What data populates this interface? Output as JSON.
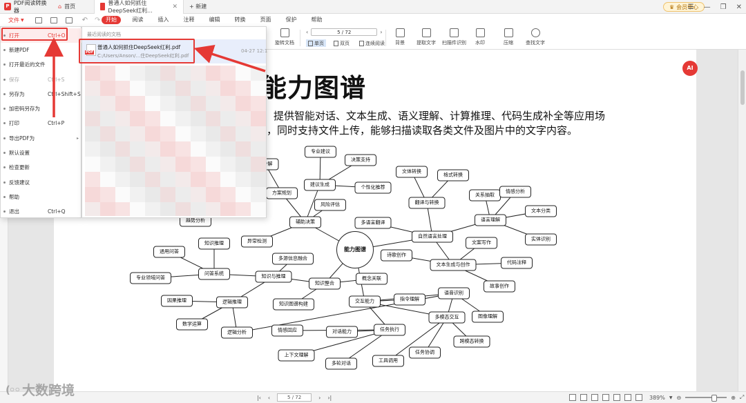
{
  "titlebar": {
    "app_title": "PDF阅读转换器",
    "home_tab": "首页",
    "doc_tab": "普通人如何抓住DeepSeek红利...",
    "new_tab": "+ 新建",
    "member": "会员中心"
  },
  "menubar": {
    "file_label": "文件",
    "tabs": [
      "开始",
      "阅读",
      "插入",
      "注释",
      "编辑",
      "转换",
      "页面",
      "保护",
      "帮助"
    ]
  },
  "ribbon": {
    "page_indicator": "5 / 72",
    "rotate": "旋转文档",
    "view_single": "单页",
    "view_double": "双页",
    "view_continuous": "连续阅读",
    "tools": [
      "背景",
      "提取文字",
      "扫描件识别",
      "水印",
      "压缩",
      "查找文字"
    ]
  },
  "file_menu": {
    "items": [
      {
        "label": "打开",
        "shortcut": "Ctrl+O"
      },
      {
        "label": "新建PDF",
        "shortcut": ""
      },
      {
        "label": "打开最近的文件",
        "shortcut": ""
      },
      {
        "label": "保存",
        "shortcut": "Ctrl+S"
      },
      {
        "label": "另存为",
        "shortcut": "Ctrl+Shift+S"
      },
      {
        "label": "加密码另存为",
        "shortcut": ""
      },
      {
        "label": "打印",
        "shortcut": "Ctrl+P"
      },
      {
        "label": "导出PDF为",
        "shortcut": ""
      },
      {
        "label": "默认设置",
        "shortcut": ""
      },
      {
        "label": "检查更新",
        "shortcut": ""
      },
      {
        "label": "反馈建议",
        "shortcut": ""
      },
      {
        "label": "帮助",
        "shortcut": ""
      },
      {
        "label": "退出",
        "shortcut": "Ctrl+Q"
      }
    ]
  },
  "recent": {
    "title": "最近阅读的文档",
    "file_name": "普通人如何抓住DeepSeek红利.pdf",
    "file_path": "C:/Users/Anson/...住DeepSeek红利.pdf",
    "time": "04-27 12:1",
    "pdf_badge": "PDF"
  },
  "document": {
    "title": "能力图谱",
    "line1": "提供智能对话、文本生成、语义理解、计算推理、代码生成补全等应用场",
    "line2": "，同时支持文件上传，能够扫描读取各类文件及图片中的文字内容。",
    "ai_bubble": "AI"
  },
  "mindmap": {
    "center": "能力图谱",
    "nodes": [
      "专业建议",
      "决策支持",
      "务分解",
      "建议生成",
      "个性化推荐",
      "方案规划",
      "风险评估",
      "辅助决策",
      "趋势分析",
      "异常检测",
      "文体转换",
      "格式转换",
      "翻译与转换",
      "多语言翻译",
      "自然语言处理",
      "关系抽取",
      "情感分析",
      "文本分类",
      "语言理解",
      "实体识别",
      "文案写作",
      "诗歌创作",
      "文本生成与创作",
      "代码注释",
      "故事创作",
      "知识推理",
      "通用问答",
      "问答系统",
      "专业领域问答",
      "多源信息融合",
      "知识与推理",
      "知识整合",
      "概念关联",
      "因果推理",
      "逻辑推理",
      "知识图谱构建",
      "交互能力",
      "指令理解",
      "数学运算",
      "逻辑分析",
      "语音识别",
      "多模态交互",
      "图像理解",
      "情感回应",
      "对话能力",
      "任务执行",
      "跨模态转换",
      "上下文理解",
      "多轮对话",
      "工具调用",
      "任务协调"
    ]
  },
  "statusbar": {
    "page": "5 / 72",
    "zoom": "389%"
  },
  "watermark": {
    "text": "大数跨境"
  },
  "colors": {
    "accent": "#e53935",
    "highlight_bg": "#e8eefb"
  }
}
